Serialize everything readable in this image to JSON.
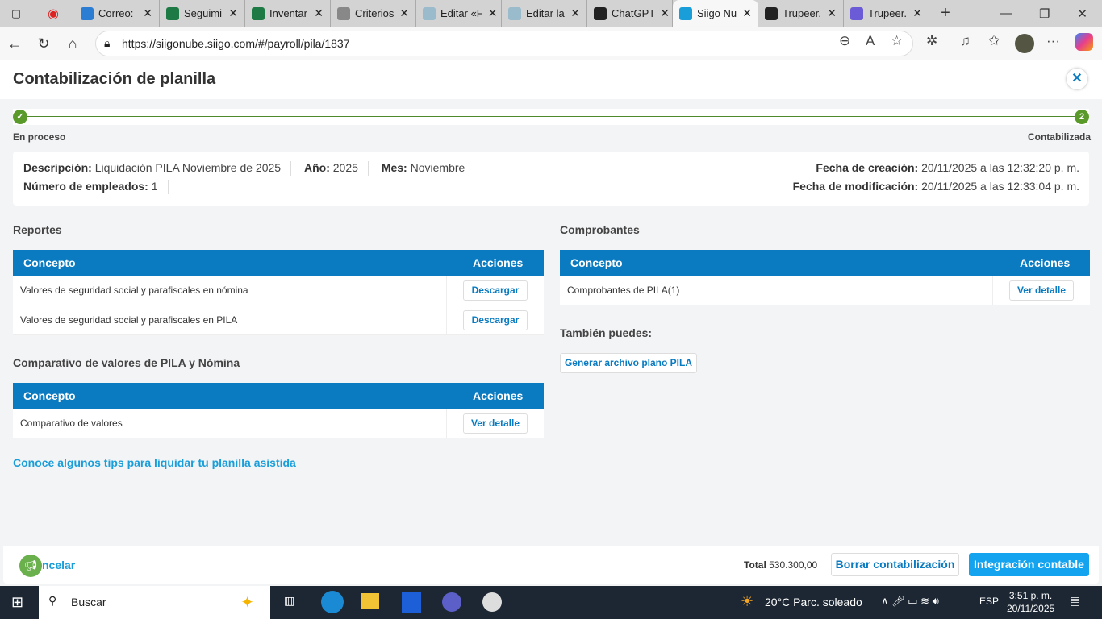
{
  "browser": {
    "tabs": [
      {
        "label": "Correo: ",
        "color": "#2b7cd3"
      },
      {
        "label": "Seguimi",
        "color": "#1d7a45"
      },
      {
        "label": "Inventar",
        "color": "#1d7a45"
      },
      {
        "label": "Criterios",
        "color": "#888"
      },
      {
        "label": "Editar «F",
        "color": "#9bc"
      },
      {
        "label": "Editar la",
        "color": "#9bc"
      },
      {
        "label": "ChatGPT",
        "color": "#222"
      },
      {
        "label": "Siigo Nu",
        "color": "#1a9ed9"
      },
      {
        "label": "Trupeer.",
        "color": "#222"
      },
      {
        "label": "Trupeer.",
        "color": "#6b5bd6"
      }
    ],
    "active_tab": 7,
    "url": "https://siigonube.siigo.com/#/payroll/pila/1837"
  },
  "page": {
    "title": "Contabilización de planilla",
    "steps": [
      {
        "label": "En proceso",
        "marker": "✓"
      },
      {
        "label": "Contabilizada",
        "marker": "2"
      }
    ],
    "info": {
      "desc_label": "Descripción:",
      "desc": "Liquidación PILA Noviembre de 2025",
      "year_label": "Año:",
      "year": "2025",
      "month_label": "Mes:",
      "month": "Noviembre",
      "emp_label": "Número de empleados:",
      "emp": "1",
      "created_label": "Fecha de creación:",
      "created": "20/11/2025 a las 12:32:20 p. m.",
      "modified_label": "Fecha de modificación:",
      "modified": "20/11/2025 a las 12:33:04 p. m."
    },
    "reportes": {
      "title": "Reportes",
      "col1": "Concepto",
      "col2": "Acciones",
      "rows": [
        {
          "concept": "Valores de seguridad social y parafiscales en nómina",
          "action": "Descargar"
        },
        {
          "concept": "Valores de seguridad social y parafiscales en PILA",
          "action": "Descargar"
        }
      ]
    },
    "comparativo": {
      "title": "Comparativo de valores de PILA y Nómina",
      "col1": "Concepto",
      "col2": "Acciones",
      "rows": [
        {
          "concept": "Comparativo de valores",
          "action": "Ver detalle"
        }
      ]
    },
    "comprobantes": {
      "title": "Comprobantes",
      "col1": "Concepto",
      "col2": "Acciones",
      "rows": [
        {
          "concept": "Comprobantes de PILA(1)",
          "action": "Ver detalle"
        }
      ]
    },
    "tambien": {
      "title": "También puedes:",
      "button": "Generar archivo plano PILA"
    },
    "tips_link": "Conoce algunos tips para liquidar tu planilla asistida",
    "footer": {
      "cancel": "ncelar",
      "total_label": "Total",
      "total": "530.300,00",
      "delete": "Borrar contabilización",
      "integrate": "Integración contable"
    }
  },
  "taskbar": {
    "search": "Buscar",
    "weather": "20°C  Parc. soleado",
    "lang": "ESP",
    "time": "3:51 p. m.",
    "date": "20/11/2025"
  }
}
